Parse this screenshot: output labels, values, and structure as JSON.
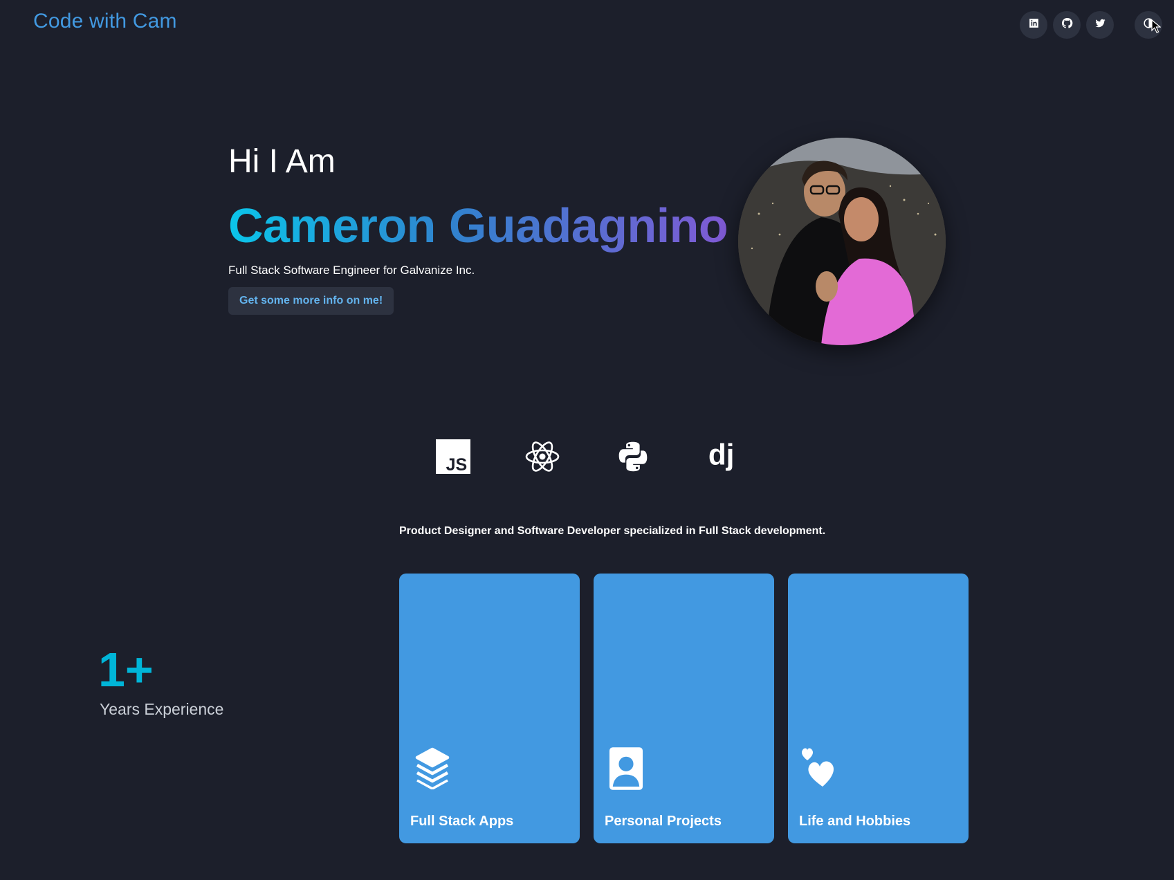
{
  "header": {
    "brand": "Code with Cam",
    "social_icons": [
      "linkedin-icon",
      "github-icon",
      "twitter-icon"
    ],
    "theme_toggle_icon": "moon-icon"
  },
  "hero": {
    "greeting": "Hi I Am",
    "name": "Cameron Guadagnino",
    "subtitle": "Full Stack Software Engineer for Galvanize Inc.",
    "cta_label": "Get some more info on me!",
    "name_gradient": [
      "#0bc5ea",
      "#3182ce",
      "#805ad5"
    ]
  },
  "tech_stack": [
    "javascript-icon",
    "react-icon",
    "python-icon",
    "django-icon"
  ],
  "tagline": "Product Designer and Software Developer specialized in Full Stack development.",
  "experience": {
    "number": "1+",
    "label": "Years Experience"
  },
  "cards": [
    {
      "title": "Full Stack Apps",
      "icon": "stack-icon"
    },
    {
      "title": "Personal Projects",
      "icon": "profile-icon"
    },
    {
      "title": "Life and Hobbies",
      "icon": "hearts-icon"
    }
  ],
  "colors": {
    "background": "#1c1f2b",
    "accent": "#4299e1",
    "card": "#4299e1",
    "experience": "#00b5d8",
    "button_bg": "#2d3240"
  }
}
